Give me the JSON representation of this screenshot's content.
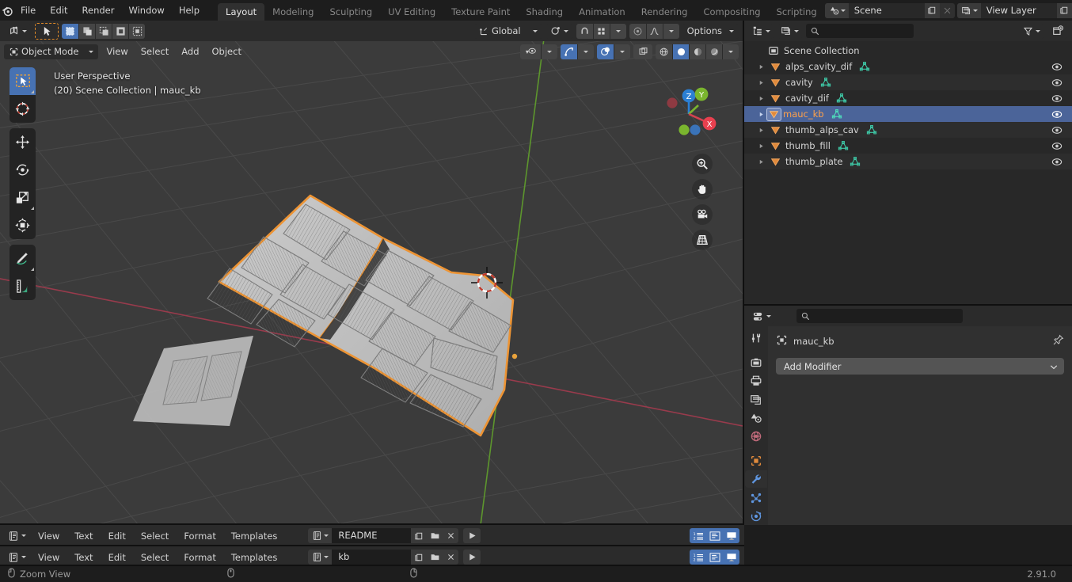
{
  "app": {
    "name": "Blender",
    "version": "2.91.0"
  },
  "topbar": {
    "menus": [
      "File",
      "Edit",
      "Render",
      "Window",
      "Help"
    ],
    "workspaces": [
      {
        "label": "Layout",
        "active": true
      },
      {
        "label": "Modeling",
        "active": false
      },
      {
        "label": "Sculpting",
        "active": false
      },
      {
        "label": "UV Editing",
        "active": false
      },
      {
        "label": "Texture Paint",
        "active": false
      },
      {
        "label": "Shading",
        "active": false
      },
      {
        "label": "Animation",
        "active": false
      },
      {
        "label": "Rendering",
        "active": false
      },
      {
        "label": "Compositing",
        "active": false
      },
      {
        "label": "Scripting",
        "active": false
      }
    ],
    "scene": {
      "icon": "scene-icon",
      "name": "Scene",
      "new_label": "new-scene-icon",
      "delete_label": "delete-scene-icon"
    },
    "view_layer": {
      "icon": "view-layer-icon",
      "name": "View Layer",
      "new_label": "new-layer-icon",
      "delete_label": "delete-layer-icon"
    }
  },
  "viewport": {
    "header": {
      "editor_type": "editor-type-3dview",
      "select_tool": "select-box-tool",
      "mode_buttons": [
        "set-new-selection",
        "extend-selection",
        "subtract-selection",
        "invert-selection",
        "intersect-selection"
      ],
      "transform_orientation": "Global",
      "pivot": "pivot-point-icon",
      "snap": "snap-magnet-icon",
      "snap_target": "snap-increment-icon",
      "proportional_edit": "proportional-editing-icon",
      "falloff": "falloff-curve-icon",
      "options_label": "Options"
    },
    "header2": {
      "mode": "Object Mode",
      "menus": [
        "View",
        "Select",
        "Add",
        "Object"
      ],
      "visibility": "object-visibility-icon",
      "gizmo": "show-gizmo-icon",
      "overlays": "show-overlays-icon",
      "xray": "toggle-xray-icon",
      "shading": [
        "wireframe-shading",
        "solid-shading",
        "material-preview-shading",
        "rendered-shading"
      ],
      "shading_active": 1
    },
    "overlay_text": {
      "line1": "User Perspective",
      "line2": "(20) Scene Collection | mauc_kb"
    },
    "toolbar": [
      {
        "name": "tweak-select-box-tool",
        "active": true,
        "corner": true
      },
      {
        "name": "cursor-tool",
        "active": false,
        "corner": false
      },
      {
        "name": "move-tool",
        "active": false,
        "corner": false
      },
      {
        "name": "rotate-tool",
        "active": false,
        "corner": false
      },
      {
        "name": "scale-tool",
        "active": false,
        "corner": true
      },
      {
        "name": "transform-tool",
        "active": false,
        "corner": false
      },
      {
        "name": "annotate-tool",
        "active": false,
        "corner": true
      },
      {
        "name": "measure-tool",
        "active": false,
        "corner": false
      }
    ],
    "gizmo_axes": [
      "Z",
      "Y",
      "X"
    ],
    "nav_buttons": [
      "zoom-view-icon",
      "pan-view-icon",
      "camera-view-icon",
      "toggle-perspective-icon"
    ],
    "colors": {
      "background": "#3b3b3b",
      "selection_outline": "#ed9434",
      "x_axis": "#a33b4d",
      "y_axis": "#6aa832",
      "object_surface": "#c3c3c3"
    }
  },
  "outliner": {
    "header": {
      "display_mode": "outliner-display-mode-icon",
      "scene_filter": "scene-filter-icon",
      "search_placeholder": "",
      "filter": "filter-funnel-icon",
      "new_collection": "new-collection-icon"
    },
    "root": {
      "label": "Scene Collection",
      "icon": "collection-icon"
    },
    "items": [
      {
        "label": "alps_cavity_dif",
        "icon": "mesh-object-icon",
        "data_icon": "mesh-data-icon",
        "selected": false,
        "visible": true
      },
      {
        "label": "cavity",
        "icon": "mesh-object-icon",
        "data_icon": "mesh-data-icon",
        "selected": false,
        "visible": true
      },
      {
        "label": "cavity_dif",
        "icon": "mesh-object-icon",
        "data_icon": "mesh-data-icon",
        "selected": false,
        "visible": true
      },
      {
        "label": "mauc_kb",
        "icon": "mesh-object-icon",
        "data_icon": "mesh-data-icon",
        "selected": true,
        "visible": true
      },
      {
        "label": "thumb_alps_cav",
        "icon": "mesh-object-icon",
        "data_icon": "mesh-data-icon",
        "selected": false,
        "visible": true
      },
      {
        "label": "thumb_fill",
        "icon": "mesh-object-icon",
        "data_icon": "mesh-data-icon",
        "selected": false,
        "visible": true
      },
      {
        "label": "thumb_plate",
        "icon": "mesh-object-icon",
        "data_icon": "mesh-data-icon",
        "selected": false,
        "visible": true
      }
    ]
  },
  "properties": {
    "header": {
      "editor_type": "editor-type-properties",
      "search_placeholder": ""
    },
    "tabs": [
      {
        "name": "tool-tab",
        "active": false
      },
      {
        "name": "render-tab",
        "active": false
      },
      {
        "name": "output-tab",
        "active": false
      },
      {
        "name": "view-layer-tab",
        "active": false
      },
      {
        "name": "scene-tab",
        "active": false
      },
      {
        "name": "world-tab",
        "active": false
      },
      {
        "name": "object-tab",
        "active": false
      },
      {
        "name": "modifier-tab",
        "active": true
      },
      {
        "name": "particles-tab",
        "active": false
      },
      {
        "name": "physics-tab",
        "active": false
      }
    ],
    "breadcrumb": {
      "object": "mauc_kb",
      "icon": "object-icon",
      "pin": "pin-icon"
    },
    "add_modifier_label": "Add Modifier"
  },
  "text_editors": [
    {
      "editor_type": "editor-type-text",
      "menus": [
        "View",
        "Text",
        "Edit",
        "Select",
        "Format",
        "Templates"
      ],
      "datablock_icon": "text-datablock-icon",
      "filename": "README",
      "buttons": [
        "new-text-icon",
        "open-text-icon",
        "unlink-text-icon"
      ],
      "run_label": "run-script-icon",
      "toggles": [
        "line-numbers-toggle",
        "word-wrap-toggle",
        "syntax-highlight-toggle"
      ]
    },
    {
      "editor_type": "editor-type-text",
      "menus": [
        "View",
        "Text",
        "Edit",
        "Select",
        "Format",
        "Templates"
      ],
      "datablock_icon": "text-datablock-icon",
      "filename": "kb",
      "buttons": [
        "new-text-icon",
        "open-text-icon",
        "unlink-text-icon"
      ],
      "run_label": "run-script-icon",
      "toggles": [
        "line-numbers-toggle",
        "word-wrap-toggle",
        "syntax-highlight-toggle"
      ]
    }
  ],
  "statusbar": {
    "keymap_label": "Zoom View",
    "mouse_icons": [
      "mouse-left-icon",
      "mouse-middle-icon",
      "mouse-right-icon"
    ],
    "version": "2.91.0"
  }
}
